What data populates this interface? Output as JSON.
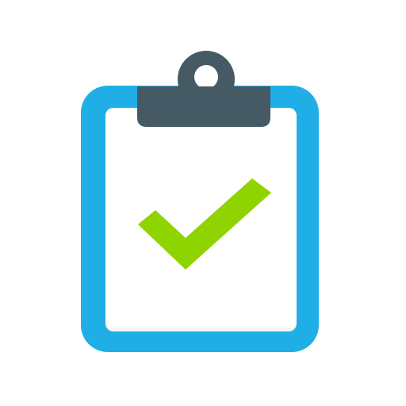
{
  "icon": {
    "name": "clipboard-check-icon",
    "colors": {
      "board_border": "#1FAFE6",
      "paper": "#F5F5F5",
      "paper_inner": "#FFFFFF",
      "clip": "#455A64",
      "check": "#8FD400",
      "background": "#FFFFFF"
    }
  }
}
